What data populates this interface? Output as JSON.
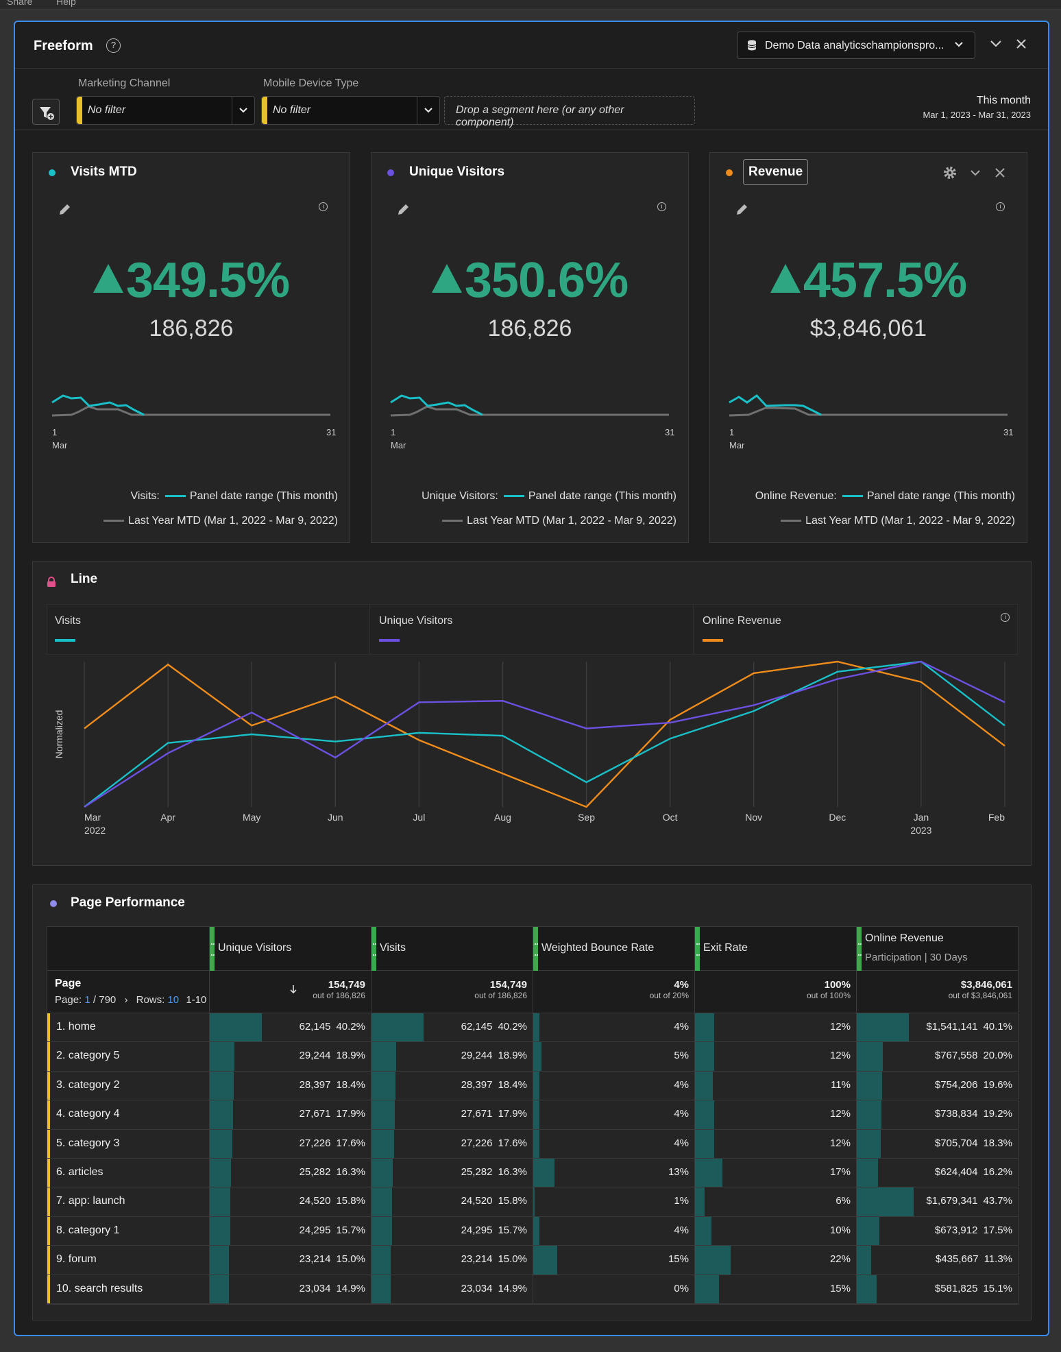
{
  "menu": {
    "left": "Share",
    "right": "Help"
  },
  "panel": {
    "title": "Freeform",
    "report_suite": "Demo Data analyticschampionspro..."
  },
  "filters": {
    "marketing_channel": {
      "label": "Marketing Channel",
      "value": "No filter"
    },
    "mobile_device": {
      "label": "Mobile Device Type",
      "value": "No filter"
    },
    "dropzone": "Drop a segment here (or any other component)",
    "date_title": "This month",
    "date_range": "Mar 1, 2023 - Mar 31, 2023"
  },
  "colors": {
    "teal": "#19c0c8",
    "purple": "#6c50e0",
    "orange": "#f08c1c",
    "green": "#2ea682",
    "grey": "#707070"
  },
  "cards": [
    {
      "title": "Visits MTD",
      "dot": "#19c0c8",
      "change": "349.5%",
      "value": "186,826",
      "axis_start": "1",
      "axis_month": "Mar",
      "axis_end": "31",
      "metric": "Visits:",
      "series1": "Panel date range (This month)",
      "series2": "Last Year MTD (Mar 1, 2022 - Mar 9, 2022)"
    },
    {
      "title": "Unique Visitors",
      "dot": "#6c50e0",
      "change": "350.6%",
      "value": "186,826",
      "axis_start": "1",
      "axis_month": "Mar",
      "axis_end": "31",
      "metric": "Unique Visitors:",
      "series1": "Panel date range (This month)",
      "series2": "Last Year MTD (Mar 1, 2022 - Mar 9, 2022)"
    },
    {
      "title": "Revenue",
      "dot": "#f08c1c",
      "change": "457.5%",
      "value": "$3,846,061",
      "axis_start": "1",
      "axis_month": "Mar",
      "axis_end": "31",
      "metric": "Online Revenue:",
      "series1": "Panel date range (This month)",
      "series2": "Last Year MTD (Mar 1, 2022 - Mar 9, 2022)"
    }
  ],
  "line_panel": {
    "title": "Line"
  },
  "chart_data": {
    "type": "line",
    "ylabel": "Normalized",
    "x": [
      "Mar",
      "Apr",
      "May",
      "Jun",
      "Jul",
      "Aug",
      "Sep",
      "Oct",
      "Nov",
      "Dec",
      "Jan",
      "Feb"
    ],
    "x_sublabels": {
      "Mar": "2022",
      "Jan": "2023"
    },
    "ylim": [
      0,
      1
    ],
    "grid": true,
    "legend_position": "top",
    "series": [
      {
        "name": "Visits",
        "color": "#19c0c8",
        "values": [
          0.0,
          0.44,
          0.5,
          0.45,
          0.51,
          0.49,
          0.17,
          0.47,
          0.66,
          0.93,
          1.0,
          0.56
        ]
      },
      {
        "name": "Unique Visitors",
        "color": "#6c50e0",
        "values": [
          0.0,
          0.37,
          0.65,
          0.34,
          0.72,
          0.73,
          0.54,
          0.58,
          0.7,
          0.88,
          1.0,
          0.72
        ]
      },
      {
        "name": "Online Revenue",
        "color": "#f08c1c",
        "values": [
          0.54,
          0.98,
          0.56,
          0.76,
          0.46,
          0.23,
          0.0,
          0.6,
          0.92,
          1.0,
          0.86,
          0.42
        ]
      }
    ]
  },
  "table": {
    "title": "Page Performance",
    "dim_header": "Page",
    "page_label": "Page:",
    "page_current": "1",
    "page_total": "/ 790",
    "rows_label": "Rows:",
    "rows_value": "10",
    "rows_range": "1-10",
    "columns": [
      {
        "name": "Unique Visitors",
        "sub": "",
        "total": "154,749",
        "out_of": "out of 186,826"
      },
      {
        "name": "Visits",
        "sub": "",
        "total": "154,749",
        "out_of": "out of 186,826"
      },
      {
        "name": "Weighted Bounce Rate",
        "sub": "",
        "total": "4%",
        "out_of": "out of 20%"
      },
      {
        "name": "Exit Rate",
        "sub": "",
        "total": "100%",
        "out_of": "out of 100%"
      },
      {
        "name": "Online Revenue",
        "sub": "Participation | 30 Days",
        "total": "$3,846,061",
        "out_of": "out of $3,846,061"
      }
    ],
    "rows": [
      {
        "name": "1.  home",
        "uv": "62,145",
        "uv_pct": "40.2%",
        "uv_f": 0.402,
        "v": "62,145",
        "v_pct": "40.2%",
        "v_f": 0.402,
        "br": "4%",
        "br_f": 0.04,
        "er": "12%",
        "er_f": 0.12,
        "rev": "$1,541,141",
        "rev_pct": "40.1%",
        "rev_f": 0.401
      },
      {
        "name": "2.  category 5",
        "uv": "29,244",
        "uv_pct": "18.9%",
        "uv_f": 0.189,
        "v": "29,244",
        "v_pct": "18.9%",
        "v_f": 0.189,
        "br": "5%",
        "br_f": 0.05,
        "er": "12%",
        "er_f": 0.12,
        "rev": "$767,558",
        "rev_pct": "20.0%",
        "rev_f": 0.2
      },
      {
        "name": "3.  category 2",
        "uv": "28,397",
        "uv_pct": "18.4%",
        "uv_f": 0.184,
        "v": "28,397",
        "v_pct": "18.4%",
        "v_f": 0.184,
        "br": "4%",
        "br_f": 0.04,
        "er": "11%",
        "er_f": 0.11,
        "rev": "$754,206",
        "rev_pct": "19.6%",
        "rev_f": 0.196
      },
      {
        "name": "4.  category 4",
        "uv": "27,671",
        "uv_pct": "17.9%",
        "uv_f": 0.179,
        "v": "27,671",
        "v_pct": "17.9%",
        "v_f": 0.179,
        "br": "4%",
        "br_f": 0.04,
        "er": "12%",
        "er_f": 0.12,
        "rev": "$738,834",
        "rev_pct": "19.2%",
        "rev_f": 0.192
      },
      {
        "name": "5.  category 3",
        "uv": "27,226",
        "uv_pct": "17.6%",
        "uv_f": 0.176,
        "v": "27,226",
        "v_pct": "17.6%",
        "v_f": 0.176,
        "br": "4%",
        "br_f": 0.04,
        "er": "12%",
        "er_f": 0.12,
        "rev": "$705,704",
        "rev_pct": "18.3%",
        "rev_f": 0.183
      },
      {
        "name": "6.  articles",
        "uv": "25,282",
        "uv_pct": "16.3%",
        "uv_f": 0.163,
        "v": "25,282",
        "v_pct": "16.3%",
        "v_f": 0.163,
        "br": "13%",
        "br_f": 0.13,
        "er": "17%",
        "er_f": 0.17,
        "rev": "$624,404",
        "rev_pct": "16.2%",
        "rev_f": 0.162
      },
      {
        "name": "7.  app: launch",
        "uv": "24,520",
        "uv_pct": "15.8%",
        "uv_f": 0.158,
        "v": "24,520",
        "v_pct": "15.8%",
        "v_f": 0.158,
        "br": "1%",
        "br_f": 0.01,
        "er": "6%",
        "er_f": 0.06,
        "rev": "$1,679,341",
        "rev_pct": "43.7%",
        "rev_f": 0.437
      },
      {
        "name": "8.  category 1",
        "uv": "24,295",
        "uv_pct": "15.7%",
        "uv_f": 0.157,
        "v": "24,295",
        "v_pct": "15.7%",
        "v_f": 0.157,
        "br": "4%",
        "br_f": 0.04,
        "er": "10%",
        "er_f": 0.1,
        "rev": "$673,912",
        "rev_pct": "17.5%",
        "rev_f": 0.175
      },
      {
        "name": "9.  forum",
        "uv": "23,214",
        "uv_pct": "15.0%",
        "uv_f": 0.15,
        "v": "23,214",
        "v_pct": "15.0%",
        "v_f": 0.15,
        "br": "15%",
        "br_f": 0.15,
        "er": "22%",
        "er_f": 0.22,
        "rev": "$435,667",
        "rev_pct": "11.3%",
        "rev_f": 0.113
      },
      {
        "name": "10.  search results",
        "uv": "23,034",
        "uv_pct": "14.9%",
        "uv_f": 0.149,
        "v": "23,034",
        "v_pct": "14.9%",
        "v_f": 0.149,
        "br": "0%",
        "br_f": 0.0,
        "er": "15%",
        "er_f": 0.15,
        "rev": "$581,825",
        "rev_pct": "15.1%",
        "rev_f": 0.151
      }
    ]
  }
}
